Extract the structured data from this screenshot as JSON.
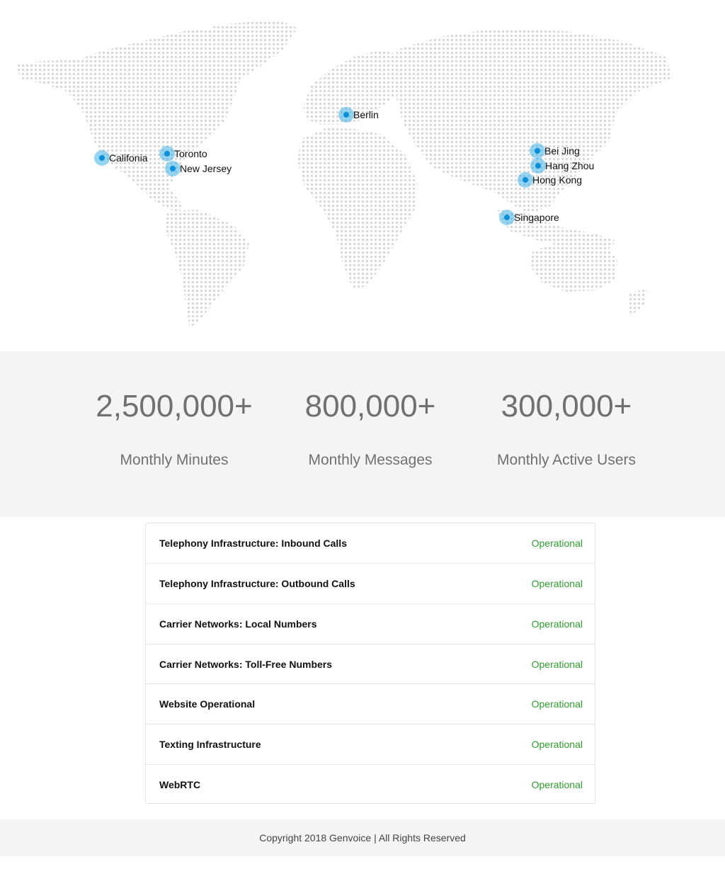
{
  "map": {
    "locations": [
      {
        "name": "Califonia"
      },
      {
        "name": "Toronto"
      },
      {
        "name": "New Jersey"
      },
      {
        "name": "Berlin"
      },
      {
        "name": "Bei Jing"
      },
      {
        "name": "Hang Zhou"
      },
      {
        "name": "Hong Kong"
      },
      {
        "name": "Singapore"
      }
    ],
    "marker_color": "#40b2e8"
  },
  "stats": [
    {
      "value": "2,500,000+",
      "label": "Monthly Minutes"
    },
    {
      "value": "800,000+",
      "label": "Monthly Messages"
    },
    {
      "value": "300,000+",
      "label": "Monthly Active Users"
    }
  ],
  "status": [
    {
      "name": "Telephony Infrastructure: Inbound Calls",
      "state": "Operational"
    },
    {
      "name": "Telephony Infrastructure: Outbound Calls",
      "state": "Operational"
    },
    {
      "name": "Carrier Networks: Local Numbers",
      "state": "Operational"
    },
    {
      "name": "Carrier Networks: Toll-Free Numbers",
      "state": "Operational"
    },
    {
      "name": "Website Operational",
      "state": "Operational"
    },
    {
      "name": "Texting Infrastructure",
      "state": "Operational"
    },
    {
      "name": "WebRTC",
      "state": "Operational"
    }
  ],
  "status_color": "#2e9e2e",
  "footer": {
    "copyright": "Copyright 2018 Genvoice | All Rights Reserved"
  }
}
